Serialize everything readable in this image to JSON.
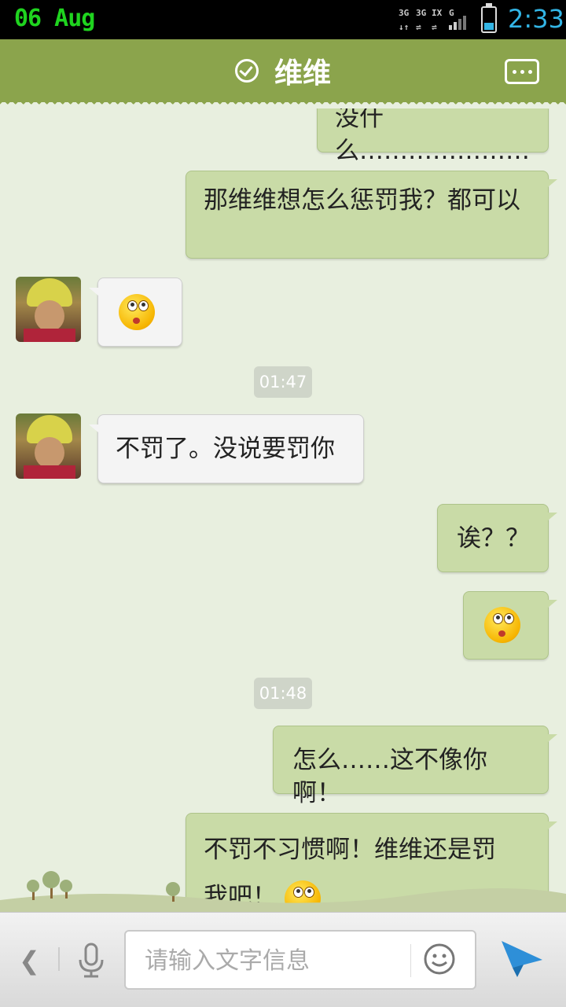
{
  "status_bar": {
    "date": "06 Aug",
    "time": "2:33",
    "network_labels": [
      "3G",
      "3G",
      "IX",
      "G"
    ]
  },
  "header": {
    "title": "维维",
    "verified_icon": "check-circle-icon",
    "more_icon": "chat-more-icon"
  },
  "messages": [
    {
      "side": "out",
      "type": "text",
      "text": "没什么…………………"
    },
    {
      "side": "out",
      "type": "text",
      "text": "那维维想怎么惩罚我？都可以"
    },
    {
      "side": "in",
      "type": "emoji",
      "emoji": "rolling-eyes-emoji"
    },
    {
      "type": "timestamp",
      "text": "01:47"
    },
    {
      "side": "in",
      "type": "text",
      "text": "不罚了。没说要罚你"
    },
    {
      "side": "out",
      "type": "text",
      "text": "诶？？"
    },
    {
      "side": "out",
      "type": "emoji",
      "emoji": "surprised-emoji"
    },
    {
      "type": "timestamp",
      "text": "01:48"
    },
    {
      "side": "out",
      "type": "text",
      "text": "怎么……这不像你啊！"
    },
    {
      "side": "out",
      "type": "text",
      "text": "不罚不习惯啊！维维还是罚我吧！",
      "line1": "不罚不习惯啊！维维还是罚",
      "line2": "我吧！",
      "emoji": "pleading-emoji"
    }
  ],
  "input_bar": {
    "placeholder": "请输入文字信息",
    "value": ""
  },
  "colors": {
    "header": "#8ba44c",
    "chat_background": "#e8efdf",
    "outgoing_bubble": "#c9dba7",
    "incoming_bubble": "#f4f4f4",
    "time_accent": "#33b5e5",
    "date_accent": "#1fd41f",
    "send_icon": "#2e8fd8"
  }
}
